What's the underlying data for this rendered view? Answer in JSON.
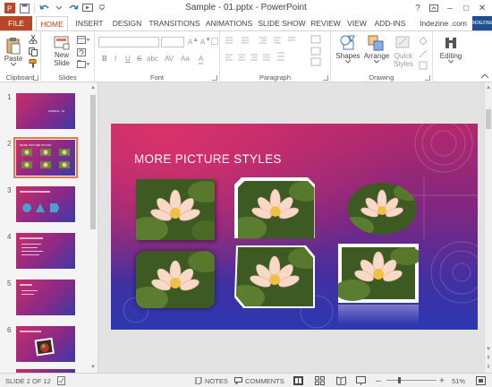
{
  "titlebar": {
    "title": "Sample - 01.pptx - PowerPoint",
    "help": "?",
    "minimize": "–",
    "maximize": "□",
    "close": "✕"
  },
  "tabs": [
    "FILE",
    "HOME",
    "INSERT",
    "DESIGN",
    "TRANSITIONS",
    "ANIMATIONS",
    "SLIDE SHOW",
    "REVIEW",
    "VIEW",
    "ADD-INS"
  ],
  "active_tab": "HOME",
  "user": {
    "name": "Indezine .com",
    "avatar_text": "INDEZINE"
  },
  "ribbon": {
    "clipboard": {
      "label": "Clipboard",
      "paste": "Paste"
    },
    "slides": {
      "label": "Slides",
      "new_slide": "New",
      "new_slide_line2": "Slide"
    },
    "font": {
      "label": "Font",
      "bold": "B",
      "italic": "I",
      "underline": "U",
      "strike": "S",
      "shadow": "abc",
      "spacing": "AV",
      "case": "Aa",
      "color": "A"
    },
    "paragraph": {
      "label": "Paragraph"
    },
    "drawing": {
      "label": "Drawing",
      "shapes": "Shapes",
      "arrange": "Arrange",
      "quick_styles": "Quick",
      "quick_styles_line2": "Styles"
    },
    "editing": {
      "label": "Editing"
    }
  },
  "thumbnails": [
    {
      "num": "1",
      "text": "SAMPLE - 01"
    },
    {
      "num": "2",
      "text": "MORE PICTURE STYLES"
    },
    {
      "num": "3",
      "text": ""
    },
    {
      "num": "4",
      "text": ""
    },
    {
      "num": "5",
      "text": ""
    },
    {
      "num": "6",
      "text": ""
    }
  ],
  "slide": {
    "title": "MORE PICTURE STYLES"
  },
  "status": {
    "slide_of": "SLIDE 2 OF 12",
    "notes": "NOTES",
    "comments": "COMMENTS",
    "zoom": "51%",
    "zoom_level": 0.51,
    "minus": "–",
    "plus": "+"
  },
  "colors": {
    "accent": "#b7472a",
    "slide_top": "#b3286c",
    "slide_bottom": "#2b38b0"
  }
}
